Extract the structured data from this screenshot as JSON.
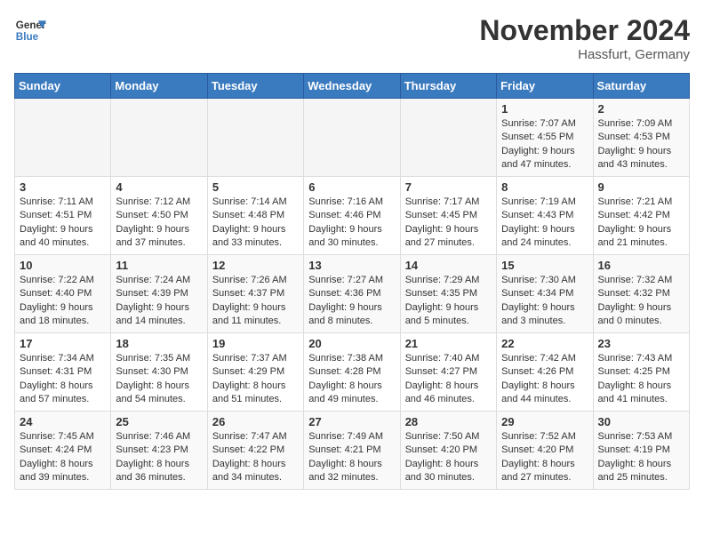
{
  "logo": {
    "line1": "General",
    "line2": "Blue"
  },
  "title": "November 2024",
  "location": "Hassfurt, Germany",
  "weekdays": [
    "Sunday",
    "Monday",
    "Tuesday",
    "Wednesday",
    "Thursday",
    "Friday",
    "Saturday"
  ],
  "weeks": [
    [
      {
        "day": "",
        "text": ""
      },
      {
        "day": "",
        "text": ""
      },
      {
        "day": "",
        "text": ""
      },
      {
        "day": "",
        "text": ""
      },
      {
        "day": "",
        "text": ""
      },
      {
        "day": "1",
        "text": "Sunrise: 7:07 AM\nSunset: 4:55 PM\nDaylight: 9 hours and 47 minutes."
      },
      {
        "day": "2",
        "text": "Sunrise: 7:09 AM\nSunset: 4:53 PM\nDaylight: 9 hours and 43 minutes."
      }
    ],
    [
      {
        "day": "3",
        "text": "Sunrise: 7:11 AM\nSunset: 4:51 PM\nDaylight: 9 hours and 40 minutes."
      },
      {
        "day": "4",
        "text": "Sunrise: 7:12 AM\nSunset: 4:50 PM\nDaylight: 9 hours and 37 minutes."
      },
      {
        "day": "5",
        "text": "Sunrise: 7:14 AM\nSunset: 4:48 PM\nDaylight: 9 hours and 33 minutes."
      },
      {
        "day": "6",
        "text": "Sunrise: 7:16 AM\nSunset: 4:46 PM\nDaylight: 9 hours and 30 minutes."
      },
      {
        "day": "7",
        "text": "Sunrise: 7:17 AM\nSunset: 4:45 PM\nDaylight: 9 hours and 27 minutes."
      },
      {
        "day": "8",
        "text": "Sunrise: 7:19 AM\nSunset: 4:43 PM\nDaylight: 9 hours and 24 minutes."
      },
      {
        "day": "9",
        "text": "Sunrise: 7:21 AM\nSunset: 4:42 PM\nDaylight: 9 hours and 21 minutes."
      }
    ],
    [
      {
        "day": "10",
        "text": "Sunrise: 7:22 AM\nSunset: 4:40 PM\nDaylight: 9 hours and 18 minutes."
      },
      {
        "day": "11",
        "text": "Sunrise: 7:24 AM\nSunset: 4:39 PM\nDaylight: 9 hours and 14 minutes."
      },
      {
        "day": "12",
        "text": "Sunrise: 7:26 AM\nSunset: 4:37 PM\nDaylight: 9 hours and 11 minutes."
      },
      {
        "day": "13",
        "text": "Sunrise: 7:27 AM\nSunset: 4:36 PM\nDaylight: 9 hours and 8 minutes."
      },
      {
        "day": "14",
        "text": "Sunrise: 7:29 AM\nSunset: 4:35 PM\nDaylight: 9 hours and 5 minutes."
      },
      {
        "day": "15",
        "text": "Sunrise: 7:30 AM\nSunset: 4:34 PM\nDaylight: 9 hours and 3 minutes."
      },
      {
        "day": "16",
        "text": "Sunrise: 7:32 AM\nSunset: 4:32 PM\nDaylight: 9 hours and 0 minutes."
      }
    ],
    [
      {
        "day": "17",
        "text": "Sunrise: 7:34 AM\nSunset: 4:31 PM\nDaylight: 8 hours and 57 minutes."
      },
      {
        "day": "18",
        "text": "Sunrise: 7:35 AM\nSunset: 4:30 PM\nDaylight: 8 hours and 54 minutes."
      },
      {
        "day": "19",
        "text": "Sunrise: 7:37 AM\nSunset: 4:29 PM\nDaylight: 8 hours and 51 minutes."
      },
      {
        "day": "20",
        "text": "Sunrise: 7:38 AM\nSunset: 4:28 PM\nDaylight: 8 hours and 49 minutes."
      },
      {
        "day": "21",
        "text": "Sunrise: 7:40 AM\nSunset: 4:27 PM\nDaylight: 8 hours and 46 minutes."
      },
      {
        "day": "22",
        "text": "Sunrise: 7:42 AM\nSunset: 4:26 PM\nDaylight: 8 hours and 44 minutes."
      },
      {
        "day": "23",
        "text": "Sunrise: 7:43 AM\nSunset: 4:25 PM\nDaylight: 8 hours and 41 minutes."
      }
    ],
    [
      {
        "day": "24",
        "text": "Sunrise: 7:45 AM\nSunset: 4:24 PM\nDaylight: 8 hours and 39 minutes."
      },
      {
        "day": "25",
        "text": "Sunrise: 7:46 AM\nSunset: 4:23 PM\nDaylight: 8 hours and 36 minutes."
      },
      {
        "day": "26",
        "text": "Sunrise: 7:47 AM\nSunset: 4:22 PM\nDaylight: 8 hours and 34 minutes."
      },
      {
        "day": "27",
        "text": "Sunrise: 7:49 AM\nSunset: 4:21 PM\nDaylight: 8 hours and 32 minutes."
      },
      {
        "day": "28",
        "text": "Sunrise: 7:50 AM\nSunset: 4:20 PM\nDaylight: 8 hours and 30 minutes."
      },
      {
        "day": "29",
        "text": "Sunrise: 7:52 AM\nSunset: 4:20 PM\nDaylight: 8 hours and 27 minutes."
      },
      {
        "day": "30",
        "text": "Sunrise: 7:53 AM\nSunset: 4:19 PM\nDaylight: 8 hours and 25 minutes."
      }
    ]
  ]
}
